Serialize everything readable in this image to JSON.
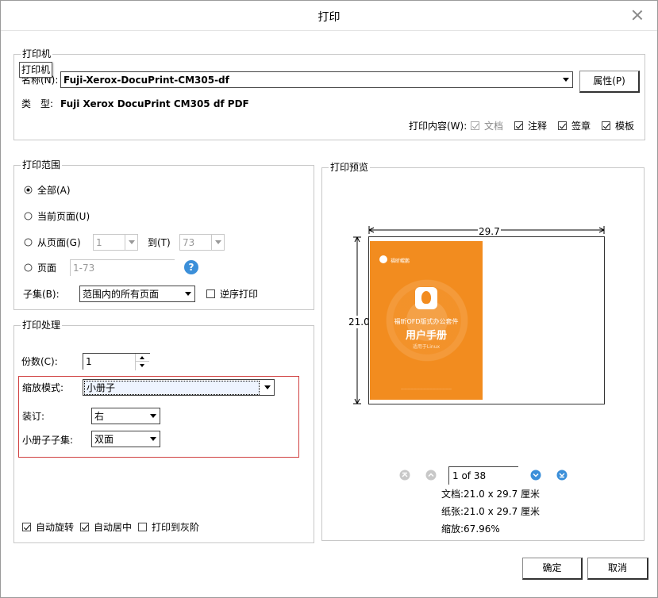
{
  "window": {
    "title": "打印"
  },
  "printer": {
    "group_label": "打印机",
    "tooltip": "打印机",
    "name_label": "名称(N):",
    "name_value": "Fuji-Xerox-DocuPrint-CM305-df",
    "properties_button": "属性(P)",
    "type_label": "类　型:",
    "type_value": "Fuji Xerox DocuPrint CM305 df PDF",
    "content_label": "打印内容(W):",
    "content_options": [
      {
        "label": "文档",
        "checked": true,
        "disabled": true
      },
      {
        "label": "注释",
        "checked": true,
        "disabled": false
      },
      {
        "label": "签章",
        "checked": true,
        "disabled": false
      },
      {
        "label": "模板",
        "checked": true,
        "disabled": false
      }
    ]
  },
  "range": {
    "group_label": "打印范围",
    "all": "全部(A)",
    "current": "当前页面(U)",
    "from_pages": "从页面(G)",
    "from_value": "1",
    "to_label": "到(T)",
    "to_value": "73",
    "pages": "页面",
    "pages_placeholder": "1-73",
    "help_icon": "?",
    "subset_label": "子集(B):",
    "subset_value": "范围内的所有页面",
    "reverse_label": "逆序打印",
    "selected": "all"
  },
  "handling": {
    "group_label": "打印处理",
    "copies_label": "份数(C):",
    "copies_value": "1",
    "scale_mode_label": "缩放模式:",
    "scale_mode_value": "小册子",
    "binding_label": "装订:",
    "binding_value": "右",
    "booklet_subset_label": "小册子子集:",
    "booklet_subset_value": "双面",
    "auto_rotate": "自动旋转",
    "auto_center": "自动居中",
    "grayscale": "打印到灰阶",
    "highlight_color": "#d04040"
  },
  "preview": {
    "group_label": "打印预览",
    "width_label": "29.7",
    "height_label": "21.0",
    "cover": {
      "brand": "福昕鲲鹏",
      "subtitle": "福昕OFD版式办公套件",
      "title": "用户手册",
      "os": "适用于Linux"
    },
    "page_indicator": "1 of 38",
    "doc_info": "文档:21.0 x 29.7 厘米",
    "paper_info": "纸张:21.0 x 29.7 厘米",
    "zoom_info": "缩放:67.96%",
    "cover_color": "#f28c1f",
    "nav_color": "#3b8fd9"
  },
  "footer": {
    "ok": "确定",
    "cancel": "取消"
  }
}
